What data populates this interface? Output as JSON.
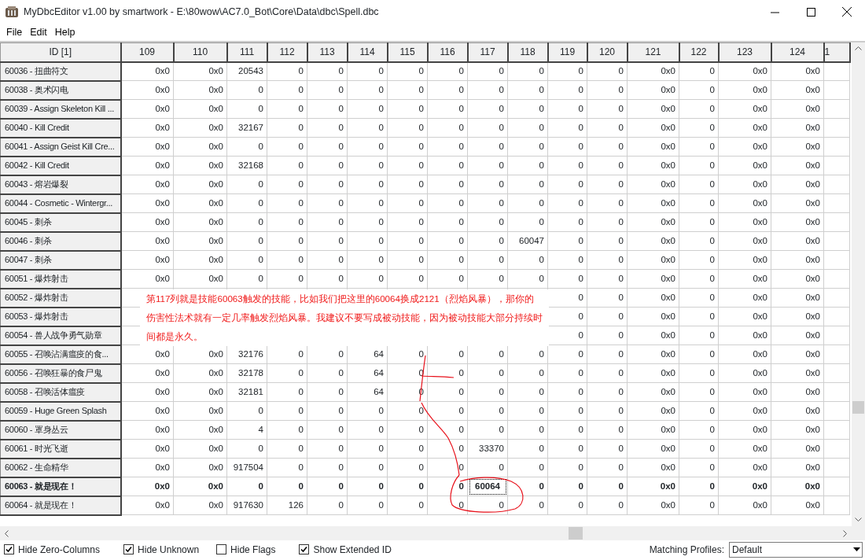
{
  "window": {
    "title": "MyDbcEditor v1.00 by smartwork - E:\\80wow\\AC7.0_Bot\\Core\\Data\\dbc\\Spell.dbc"
  },
  "menu": [
    "File",
    "Edit",
    "Help"
  ],
  "columns": [
    "ID [1]",
    "109",
    "110",
    "111",
    "112",
    "113",
    "114",
    "115",
    "116",
    "117",
    "118",
    "119",
    "120",
    "121",
    "122",
    "123",
    "124",
    "1"
  ],
  "rows": [
    {
      "id": "60036 - 扭曲符文",
      "selected": false,
      "cells": [
        "0x0",
        "0x0",
        "20543",
        "0",
        "0",
        "0",
        "0",
        "0",
        "0",
        "0",
        "0",
        "0",
        "0x0",
        "0",
        "0x0",
        "0x0"
      ]
    },
    {
      "id": "60038 - 奥术闪电",
      "selected": false,
      "cells": [
        "0x0",
        "0x0",
        "0",
        "0",
        "0",
        "0",
        "0",
        "0",
        "0",
        "0",
        "0",
        "0",
        "0x0",
        "0",
        "0x0",
        "0x0"
      ]
    },
    {
      "id": "60039 - Assign Skeleton Kill ...",
      "selected": false,
      "cells": [
        "0x0",
        "0x0",
        "0",
        "0",
        "0",
        "0",
        "0",
        "0",
        "0",
        "0",
        "0",
        "0",
        "0x0",
        "0",
        "0x0",
        "0x0"
      ]
    },
    {
      "id": "60040 - Kill Credit",
      "selected": false,
      "cells": [
        "0x0",
        "0x0",
        "32167",
        "0",
        "0",
        "0",
        "0",
        "0",
        "0",
        "0",
        "0",
        "0",
        "0x0",
        "0",
        "0x0",
        "0x0"
      ]
    },
    {
      "id": "60041 - Assign Geist Kill Cre...",
      "selected": false,
      "cells": [
        "0x0",
        "0x0",
        "0",
        "0",
        "0",
        "0",
        "0",
        "0",
        "0",
        "0",
        "0",
        "0",
        "0x0",
        "0",
        "0x0",
        "0x0"
      ]
    },
    {
      "id": "60042 - Kill Credit",
      "selected": false,
      "cells": [
        "0x0",
        "0x0",
        "32168",
        "0",
        "0",
        "0",
        "0",
        "0",
        "0",
        "0",
        "0",
        "0",
        "0x0",
        "0",
        "0x0",
        "0x0"
      ]
    },
    {
      "id": "60043 - 熔岩爆裂",
      "selected": false,
      "cells": [
        "0x0",
        "0x0",
        "0",
        "0",
        "0",
        "0",
        "0",
        "0",
        "0",
        "0",
        "0",
        "0",
        "0x0",
        "0",
        "0x0",
        "0x0"
      ]
    },
    {
      "id": "60044 - Cosmetic - Wintergr...",
      "selected": false,
      "cells": [
        "0x0",
        "0x0",
        "0",
        "0",
        "0",
        "0",
        "0",
        "0",
        "0",
        "0",
        "0",
        "0",
        "0x0",
        "0",
        "0x0",
        "0x0"
      ]
    },
    {
      "id": "60045 - 刺杀",
      "selected": false,
      "cells": [
        "0x0",
        "0x0",
        "0",
        "0",
        "0",
        "0",
        "0",
        "0",
        "0",
        "0",
        "0",
        "0",
        "0x0",
        "0",
        "0x0",
        "0x0"
      ]
    },
    {
      "id": "60046 - 刺杀",
      "selected": false,
      "cells": [
        "0x0",
        "0x0",
        "0",
        "0",
        "0",
        "0",
        "0",
        "0",
        "0",
        "60047",
        "0",
        "0",
        "0x0",
        "0",
        "0x0",
        "0x0"
      ]
    },
    {
      "id": "60047 - 刺杀",
      "selected": false,
      "cells": [
        "0x0",
        "0x0",
        "0",
        "0",
        "0",
        "0",
        "0",
        "0",
        "0",
        "0",
        "0",
        "0",
        "0x0",
        "0",
        "0x0",
        "0x0"
      ]
    },
    {
      "id": "60051 - 爆炸射击",
      "selected": false,
      "cells": [
        "0x0",
        "0x0",
        "0",
        "0",
        "0",
        "0",
        "0",
        "0",
        "0",
        "0",
        "0",
        "0",
        "0x0",
        "0",
        "0x0",
        "0x0"
      ]
    },
    {
      "id": "60052 - 爆炸射击",
      "selected": false,
      "cells": [
        null,
        null,
        null,
        null,
        null,
        null,
        null,
        null,
        null,
        null,
        "0",
        "0",
        "0x0",
        "0",
        "0x0",
        "0x0"
      ]
    },
    {
      "id": "60053 - 爆炸射击",
      "selected": false,
      "cells": [
        null,
        null,
        null,
        null,
        null,
        null,
        null,
        null,
        null,
        null,
        "0",
        "0",
        "0x0",
        "0",
        "0x0",
        "0x0"
      ]
    },
    {
      "id": "60054 - 兽人战争勇气勋章",
      "selected": false,
      "cells": [
        null,
        null,
        null,
        null,
        null,
        null,
        null,
        null,
        null,
        null,
        "0",
        "0",
        "0x0",
        "0",
        "0x0",
        "0x0"
      ]
    },
    {
      "id": "60055 - 召唤沾满瘟疫的食...",
      "selected": false,
      "cells": [
        "0x0",
        "0x0",
        "32176",
        "0",
        "0",
        "64",
        "0",
        "0",
        "0",
        "0",
        "0",
        "0",
        "0x0",
        "0",
        "0x0",
        "0x0"
      ]
    },
    {
      "id": "60056 - 召唤狂暴的食尸鬼",
      "selected": false,
      "cells": [
        "0x0",
        "0x0",
        "32178",
        "0",
        "0",
        "64",
        "0",
        "0",
        "0",
        "0",
        "0",
        "0",
        "0x0",
        "0",
        "0x0",
        "0x0"
      ]
    },
    {
      "id": "60058 - 召唤活体瘟疫",
      "selected": false,
      "cells": [
        "0x0",
        "0x0",
        "32181",
        "0",
        "0",
        "64",
        "0",
        "0",
        "0",
        "0",
        "0",
        "0",
        "0x0",
        "0",
        "0x0",
        "0x0"
      ]
    },
    {
      "id": "60059 - Huge Green Splash",
      "selected": false,
      "cells": [
        "0x0",
        "0x0",
        "0",
        "0",
        "0",
        "0",
        "0",
        "0",
        "0",
        "0",
        "0",
        "0",
        "0x0",
        "0",
        "0x0",
        "0x0"
      ]
    },
    {
      "id": "60060 - 罩身丛云",
      "selected": false,
      "cells": [
        "0x0",
        "0x0",
        "4",
        "0",
        "0",
        "0",
        "0",
        "0",
        "0",
        "0",
        "0",
        "0",
        "0x0",
        "0",
        "0x0",
        "0x0"
      ]
    },
    {
      "id": "60061 - 时光飞逝",
      "selected": false,
      "cells": [
        "0x0",
        "0x0",
        "0",
        "0",
        "0",
        "0",
        "0",
        "0",
        "33370",
        "0",
        "0",
        "0",
        "0x0",
        "0",
        "0x0",
        "0x0"
      ]
    },
    {
      "id": "60062 - 生命精华",
      "selected": false,
      "cells": [
        "0x0",
        "0x0",
        "917504",
        "0",
        "0",
        "0",
        "0",
        "0",
        "0",
        "0",
        "0",
        "0",
        "0x0",
        "0",
        "0x0",
        "0x0"
      ]
    },
    {
      "id": "60063 - 就是现在！",
      "selected": true,
      "cells": [
        "0x0",
        "0x0",
        "0",
        "0",
        "0",
        "0",
        "0",
        "0",
        {
          "value": "60064",
          "focused": true
        },
        "0",
        "0",
        "0",
        "0x0",
        "0",
        "0x0",
        "0x0"
      ]
    },
    {
      "id": "60064 - 就是现在！",
      "selected": false,
      "cells": [
        "0x0",
        "0x0",
        "917630",
        "126",
        "0",
        "0",
        "0",
        "0",
        "0",
        "0",
        "0",
        "0",
        "0x0",
        "0",
        "0x0",
        "0x0"
      ]
    }
  ],
  "annotation": {
    "text": "第117列就是技能60063触发的技能，比如我们把这里的60064换成2121（烈焰风暴），那你的伤害性法术就有一定几率触发烈焰风暴。我建议不要写成被动技能，因为被动技能大部分持续时间都是永久。"
  },
  "options": [
    {
      "label": "Hide Zero-Columns",
      "checked": true
    },
    {
      "label": "Hide Unknown",
      "checked": true
    },
    {
      "label": "Hide Flags",
      "checked": false
    },
    {
      "label": "Show Extended ID",
      "checked": true
    }
  ],
  "profiles": {
    "label": "Matching Profiles:",
    "value": "Default"
  }
}
